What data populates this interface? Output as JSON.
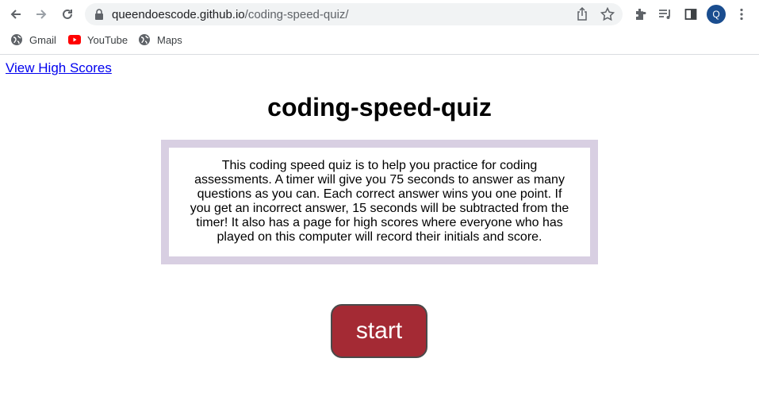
{
  "browser": {
    "url_domain": "queendoescode.github.io",
    "url_path": "/coding-speed-quiz/",
    "profile_initial": "Q",
    "bookmarks": [
      {
        "label": "Gmail",
        "icon": "globe-icon"
      },
      {
        "label": "YouTube",
        "icon": "youtube-icon"
      },
      {
        "label": "Maps",
        "icon": "globe-icon"
      }
    ]
  },
  "page": {
    "high_scores_link": "View High Scores",
    "title": "coding-speed-quiz",
    "description": "This coding speed quiz is to help you practice for coding assessments. A timer will give you 75 seconds to answer as many questions as you can. Each correct answer wins you one point. If you get an incorrect answer, 15 seconds will be subtracted from the timer! It also has a page for high scores where everyone who has played on this computer will record their initials and score.",
    "start_label": "start"
  },
  "colors": {
    "description_border": "#d8cfe2",
    "start_button": "#a42a34",
    "link": "#0000ee",
    "avatar": "#1a4d8f"
  }
}
